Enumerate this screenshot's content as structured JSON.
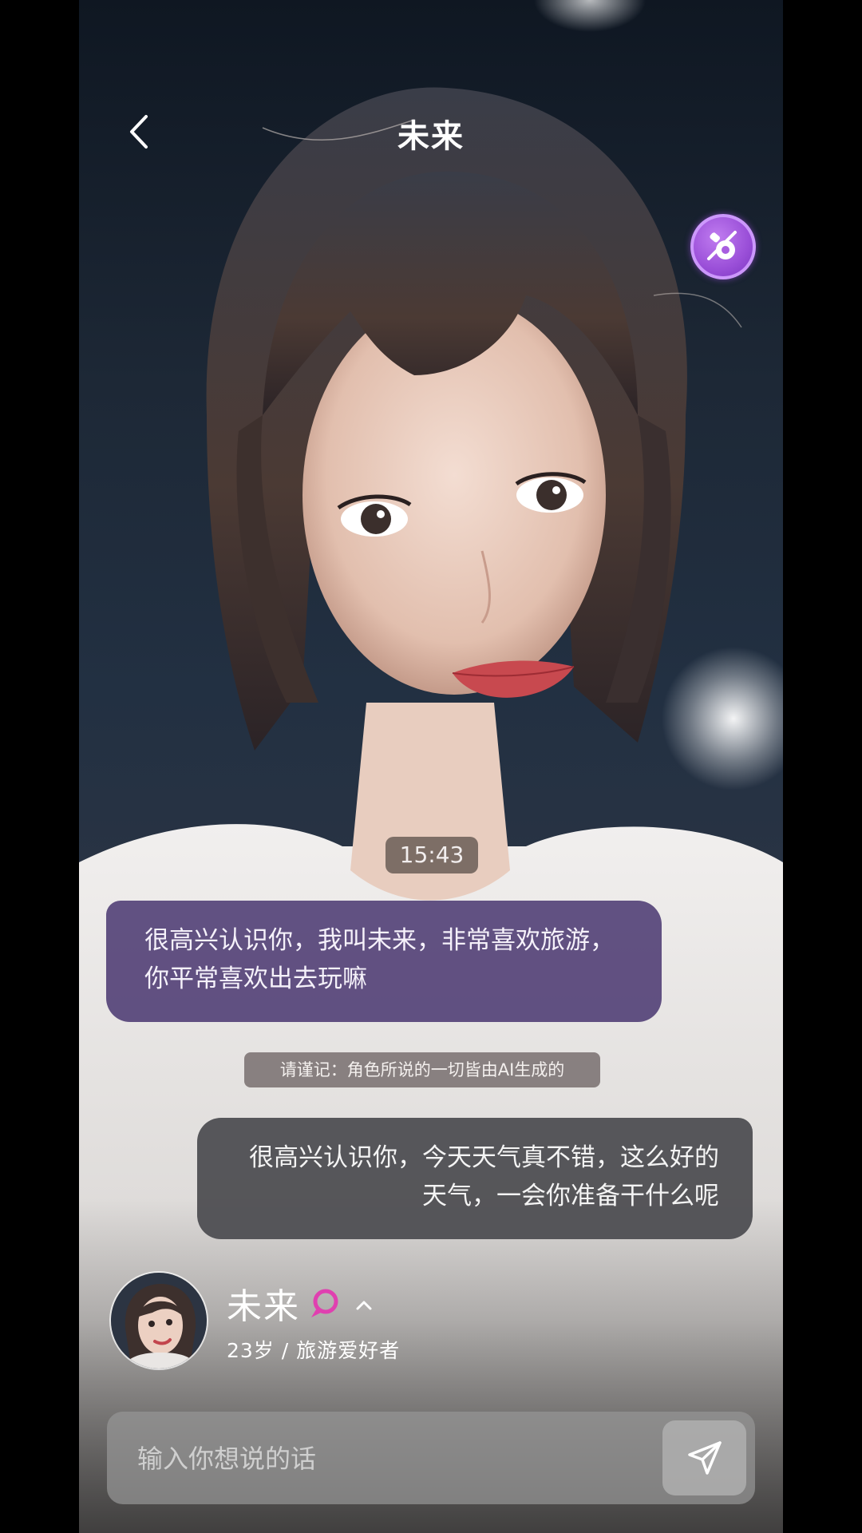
{
  "header": {
    "title": "未来",
    "back_icon": "chevron-left-icon"
  },
  "floating_button": {
    "icon": "pacifier-icon",
    "color": "#9a4fd8"
  },
  "chat": {
    "timestamp": "15:43",
    "messages": [
      {
        "side": "left",
        "text": "很高兴认识你，我叫未来，非常喜欢旅游，你平常喜欢出去玩嘛",
        "bubble_color": "#5b4a7d"
      },
      {
        "side": "right",
        "text": "很高兴认识你，今天天气真不错，这么好的天气，一会你准备干什么呢",
        "bubble_color": "#4e4e52"
      }
    ],
    "notice": "请谨记：角色所说的一切皆由AI生成的"
  },
  "profile": {
    "name": "未来",
    "badge_icon": "speech-bubble-icon",
    "badge_color": "#e040b0",
    "expand_icon": "chevron-up-icon",
    "description": "23岁 / 旅游爱好者"
  },
  "input": {
    "placeholder": "输入你想说的话",
    "value": "",
    "send_icon": "paper-plane-icon"
  }
}
